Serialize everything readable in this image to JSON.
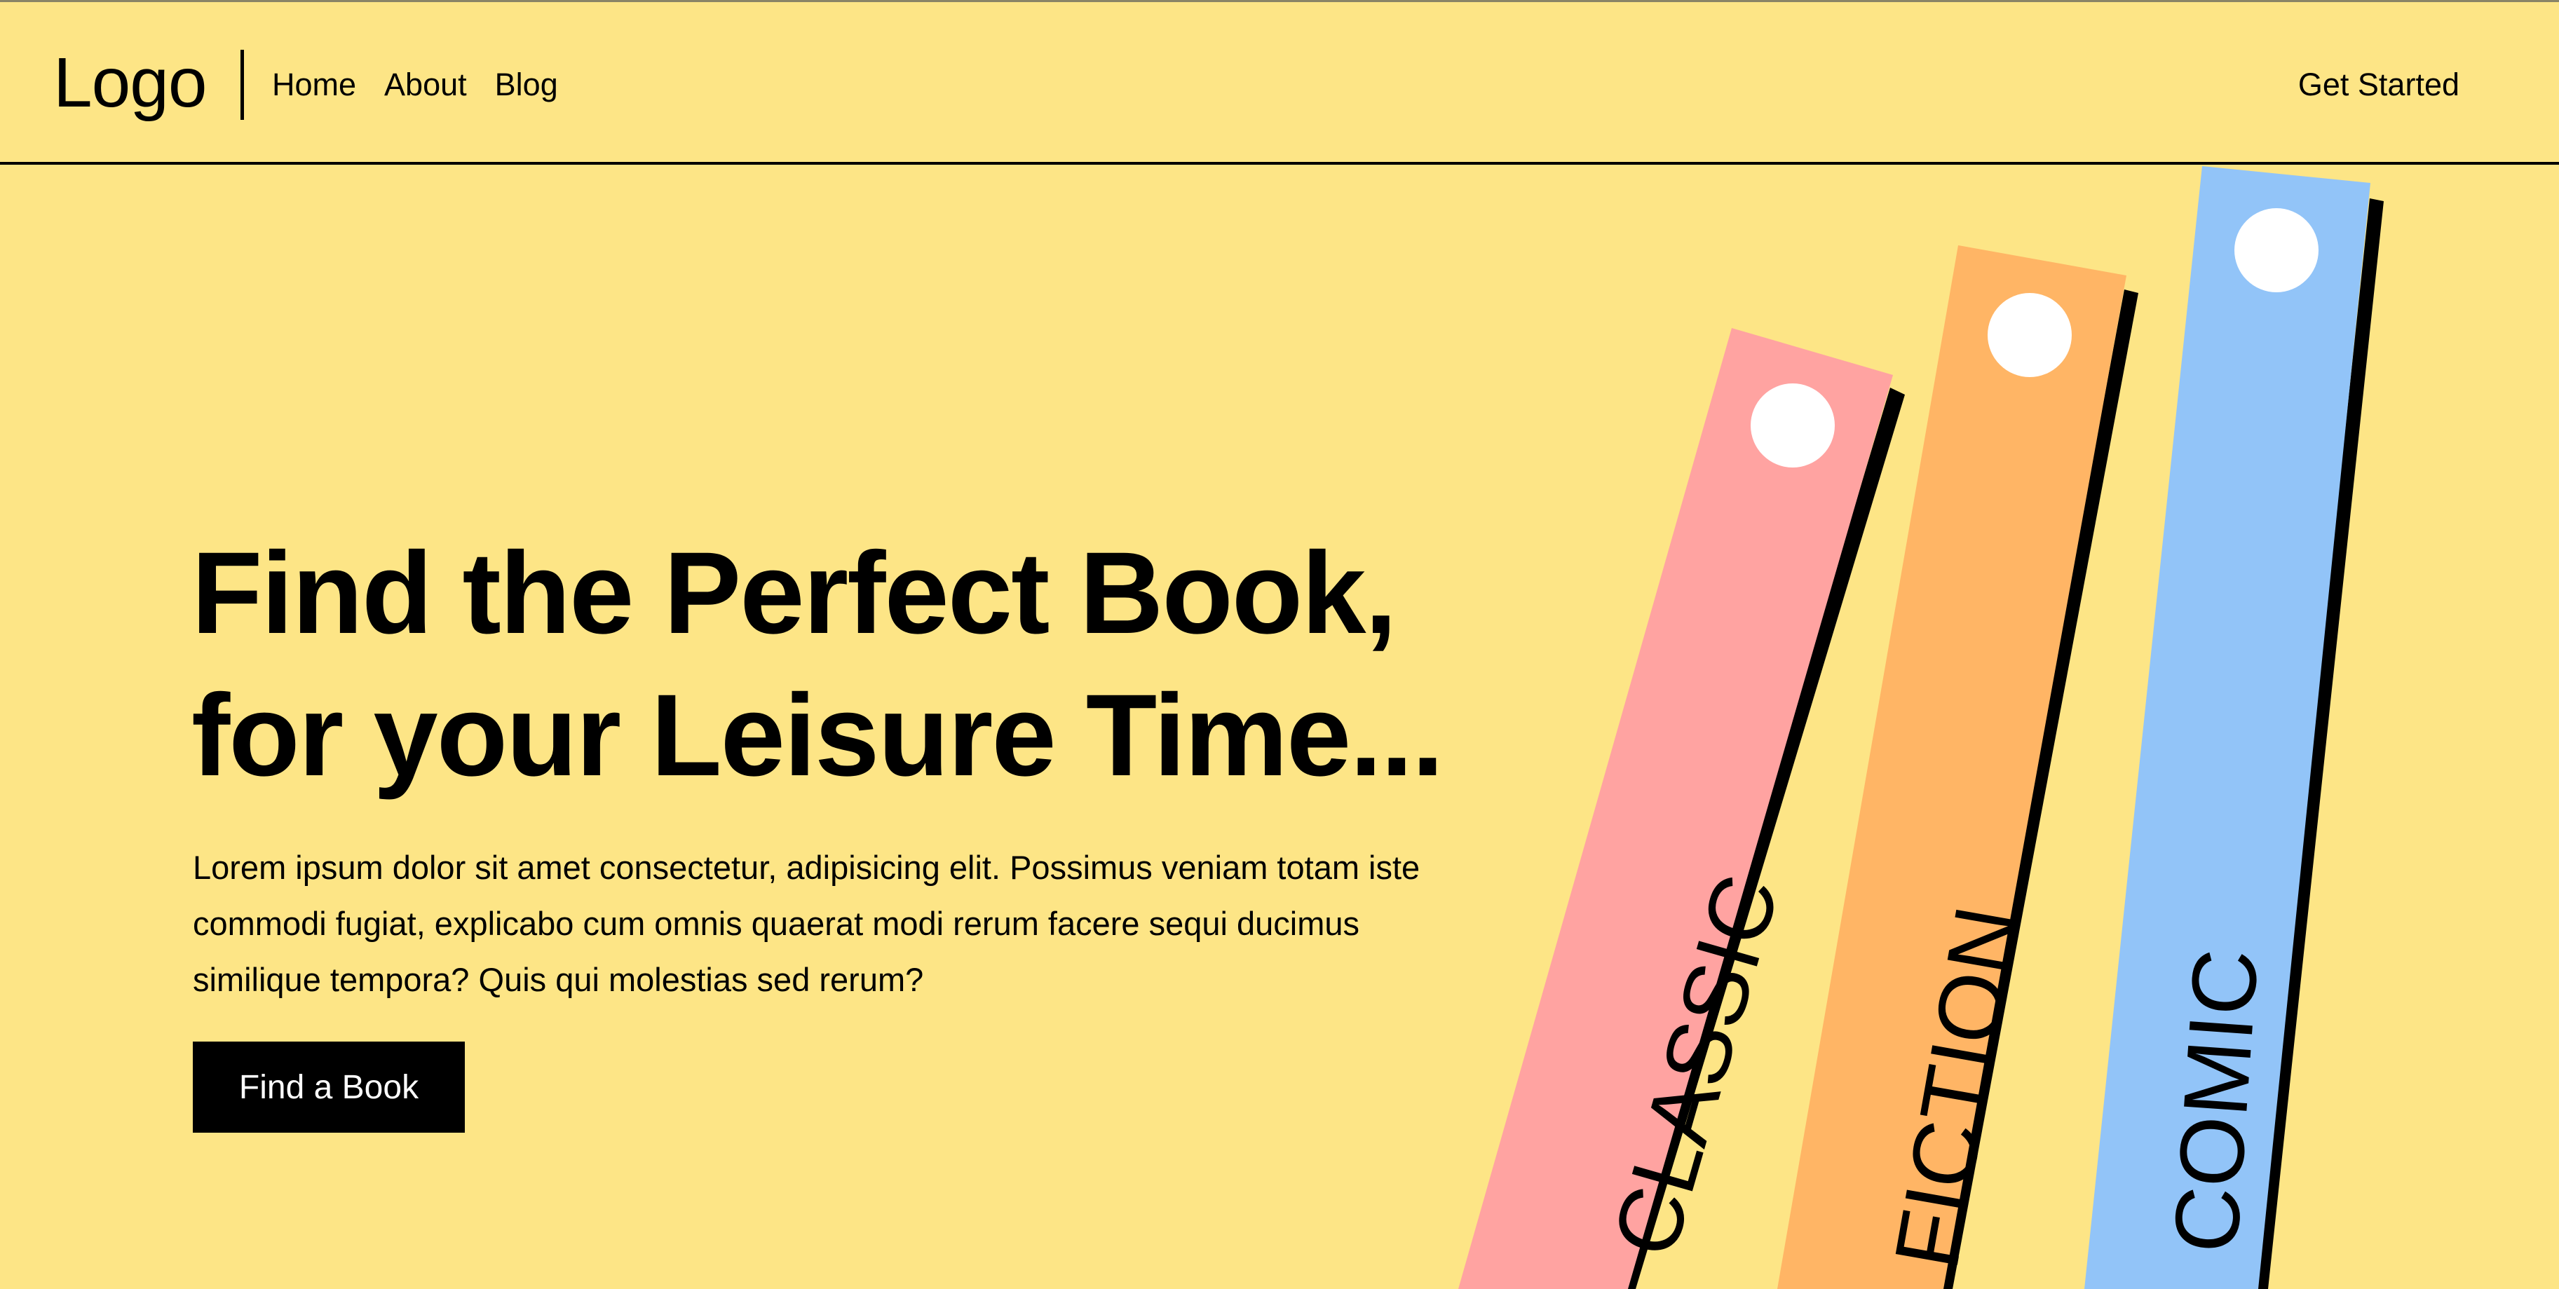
{
  "navbar": {
    "logo": "Logo",
    "links": [
      {
        "label": "Home"
      },
      {
        "label": "About"
      },
      {
        "label": "Blog"
      }
    ],
    "cta": "Get Started"
  },
  "hero": {
    "title_line1": "Find the Perfect Book,",
    "title_line2": "for your Leisure Time...",
    "description": "Lorem ipsum dolor sit amet consectetur, adipisicing elit. Possimus veniam totam iste commodi fugiat, explicabo cum omnis quaerat modi rerum facere sequi ducimus similique tempora? Quis qui molestias sed rerum?",
    "button_label": "Find a Book"
  },
  "books": [
    {
      "label": "CLASSIC",
      "color": "#FFA3A1"
    },
    {
      "label": "FICTION",
      "color": "#FFB565"
    },
    {
      "label": "COMIC",
      "color": "#92C4F8"
    }
  ],
  "colors": {
    "background": "#FDE586",
    "text": "#000000",
    "button_bg": "#000000",
    "button_text": "#FFFFFF"
  }
}
